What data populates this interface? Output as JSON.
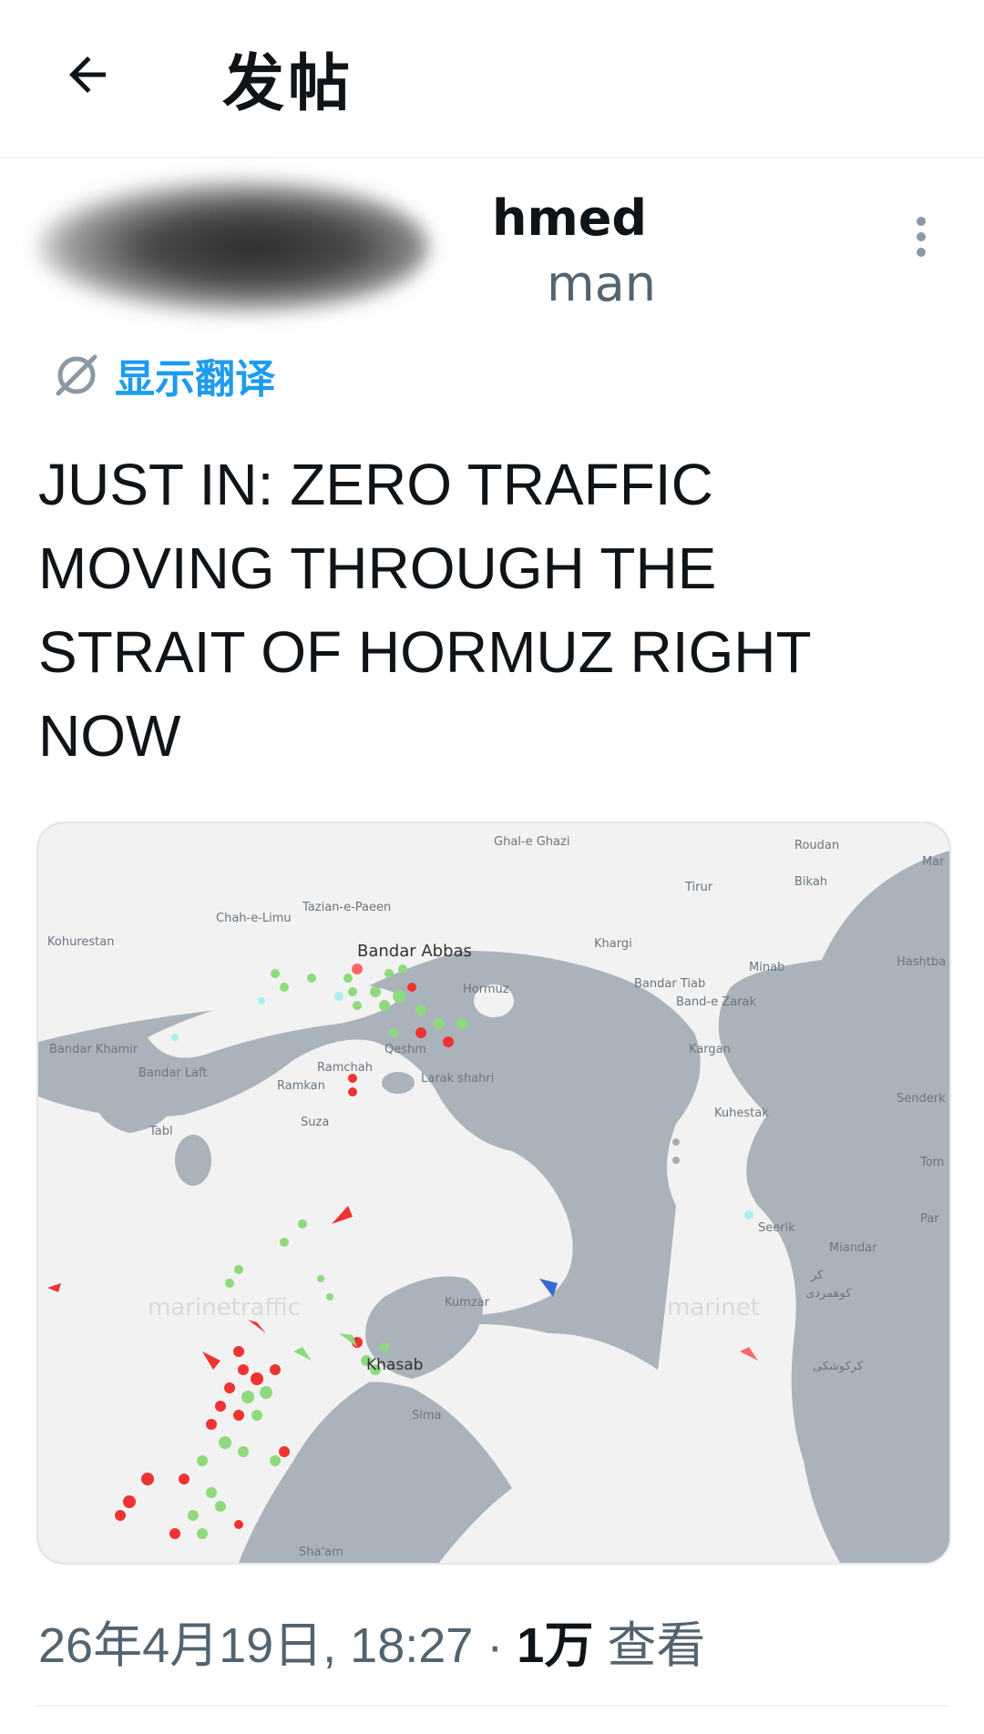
{
  "header": {
    "title": "发帖",
    "back_icon": "arrow-left-icon"
  },
  "author": {
    "name_partial": "hmed",
    "handle_partial": "man"
  },
  "translate": {
    "label": "显示翻译",
    "icon": "globe-translate-icon"
  },
  "post": {
    "text": "JUST IN: ZERO TRAFFIC MOVING THROUGH THE STRAIT OF HORMUZ RIGHT NOW"
  },
  "map": {
    "watermark": "marinetraffic",
    "watermark2": "marinet",
    "places": {
      "ghal_e_ghazi": "Ghal-e Ghazi",
      "roudan": "Roudan",
      "mar": "Mar",
      "tirur": "Tirur",
      "bikah": "Bikah",
      "tazian": "Tazian-e-Paeen",
      "chah_e_limu": "Chah-e-Limu",
      "kohurestan": "Kohurestan",
      "bandar_abbas": "Bandar Abbas",
      "khargi": "Khargi",
      "minab": "Minab",
      "hashtba": "Hashtba",
      "hormuz": "Hormuz",
      "bandar_tiab": "Bandar Tiab",
      "band_e_zarak": "Band-e Zarak",
      "bandar_khamir": "Bandar Khamir",
      "qeshm": "Qeshm",
      "kargan": "Kargan",
      "bandar_laft": "Bandar Laft",
      "ramchah": "Ramchah",
      "larak": "Larak shahri",
      "ramkan": "Ramkan",
      "sender": "Senderk",
      "kuhestak": "Kuhestak",
      "suza": "Suza",
      "tabl": "Tabl",
      "tom": "Tom",
      "par": "Par",
      "jask_area": "Seerik",
      "miandar": "Miandar",
      "kr": "کر",
      "kumzar": "Kumzar",
      "kuhmardi": "کوهمردی",
      "khasab": "Khasab",
      "karkushki": "کرکوشکی",
      "sima": "Sima",
      "shaam": "Sha'am"
    }
  },
  "meta": {
    "date": "26年4月19日, 18:27 · ",
    "views_count": "1万",
    "views_label": " 查看"
  },
  "colors": {
    "accent": "#1d9bf0",
    "text": "#0f1419",
    "secondary": "#536471",
    "land": "#f2f2f2",
    "sea": "#aab3bb"
  }
}
